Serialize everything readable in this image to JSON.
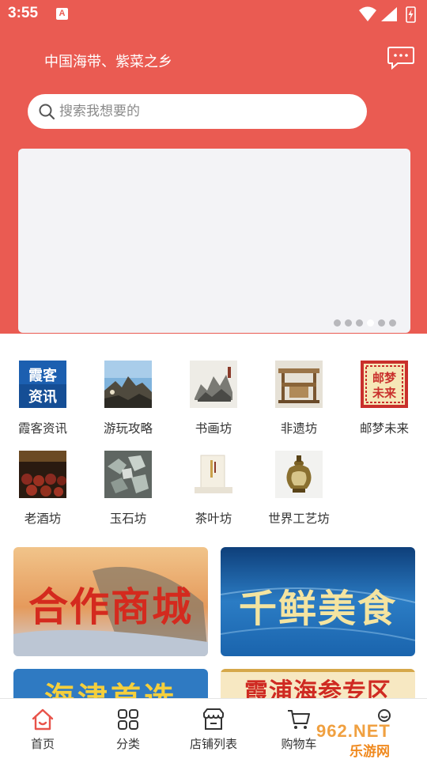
{
  "status_bar": {
    "time": "3:55",
    "notif_icon": "A"
  },
  "header": {
    "slogan": "中国海带、紫菜之乡",
    "chat_icon": "chat-bubble-icon"
  },
  "search": {
    "placeholder": "搜索我想要的"
  },
  "banner": {
    "dots": 6,
    "active_dot": 3
  },
  "categories": [
    {
      "label": "霞客资讯",
      "badge_text": [
        "霞客",
        "资讯"
      ]
    },
    {
      "label": "游玩攻略"
    },
    {
      "label": "书画坊"
    },
    {
      "label": "非遗坊"
    },
    {
      "label": "邮梦未来",
      "badge_text": [
        "邮梦",
        "未来"
      ]
    },
    {
      "label": "老酒坊"
    },
    {
      "label": "玉石坊"
    },
    {
      "label": "茶叶坊"
    },
    {
      "label": "世界工艺坊"
    }
  ],
  "promos": [
    {
      "text": "合作商城"
    },
    {
      "text": "千鲜美食"
    },
    {
      "text": "海津首选"
    },
    {
      "text": "霞浦海参专区"
    }
  ],
  "bottom_nav": [
    {
      "label": "首页",
      "icon": "home-icon"
    },
    {
      "label": "分类",
      "icon": "grid-icon"
    },
    {
      "label": "店铺列表",
      "icon": "store-icon"
    },
    {
      "label": "购物车",
      "icon": "cart-icon"
    },
    {
      "label": "",
      "icon": "user-icon"
    }
  ],
  "watermark": {
    "logo": "962.NET",
    "sub": "乐游网"
  },
  "colors": {
    "brand_red": "#ea5b52",
    "banner_gray": "#f3f3f6"
  }
}
